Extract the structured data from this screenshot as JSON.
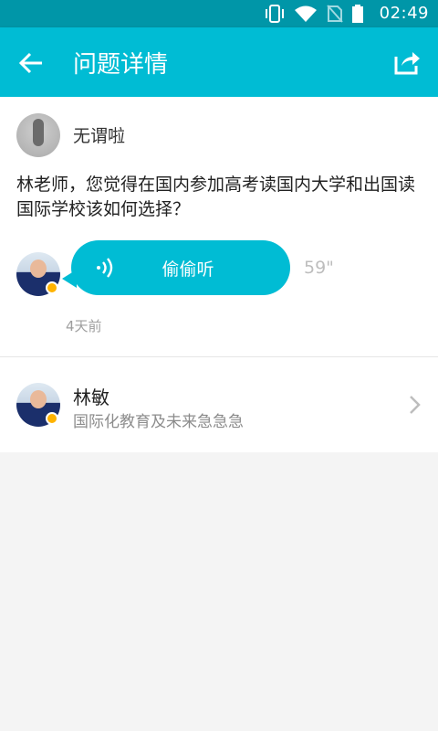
{
  "status_bar": {
    "time": "02:49"
  },
  "app_bar": {
    "title": "问题详情"
  },
  "question": {
    "asker_name": "无谓啦",
    "text": "林老师，您觉得在国内参加高考读国内大学和出国读国际学校该如何选择？"
  },
  "answer": {
    "voice_label": "偷偷听",
    "duration": "59\"",
    "time_ago": "4天前"
  },
  "expert": {
    "name": "林敏",
    "description": "国际化教育及未来急急急"
  },
  "colors": {
    "primary": "#00bcd4",
    "status_bar": "#0096a8",
    "badge": "#ffb300"
  },
  "icons": [
    "back-arrow-icon",
    "share-icon",
    "sound-wave-icon",
    "chevron-right-icon",
    "vibrate-icon",
    "wifi-icon",
    "no-sim-icon",
    "battery-icon"
  ]
}
